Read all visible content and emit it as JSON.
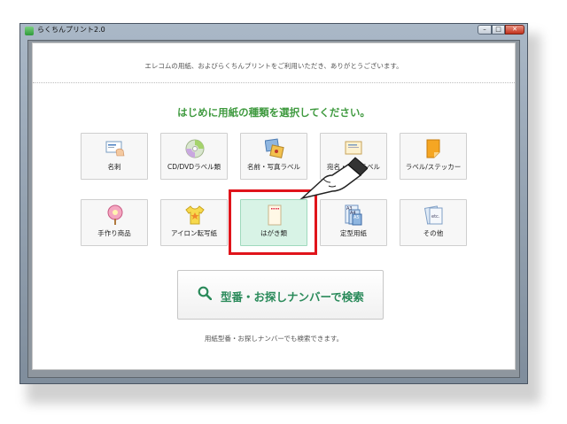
{
  "window": {
    "title": "らくちんプリント2.0",
    "min_label": "–",
    "max_label": "□",
    "close_label": "✕"
  },
  "main": {
    "welcome": "エレコムの用紙、およびらくちんプリントをご利用いただき、ありがとうございます。",
    "heading": "はじめに用紙の種類を選択してください。",
    "tiles": [
      {
        "label": "名刺",
        "icon": "business-card-icon"
      },
      {
        "label": "CD/DVDラベル類",
        "icon": "disc-icon"
      },
      {
        "label": "名前・写真ラベル",
        "icon": "photo-label-icon"
      },
      {
        "label": "宛名・表示ラベル",
        "icon": "address-label-icon"
      },
      {
        "label": "ラベル/ステッカー",
        "icon": "sticker-icon"
      },
      {
        "label": "手作り商品",
        "icon": "fan-icon"
      },
      {
        "label": "アイロン転写紙",
        "icon": "tshirt-icon"
      },
      {
        "label": "はがき類",
        "icon": "postcard-icon",
        "selected": true
      },
      {
        "label": "定型用紙",
        "icon": "paper-sizes-icon"
      },
      {
        "label": "その他",
        "icon": "other-icon"
      }
    ],
    "search_button": "型番・お探しナンバーで検索",
    "note": "用紙型番・お探しナンバーでも検索できます。"
  },
  "colors": {
    "heading": "#3f9a3f",
    "highlight": "#e0141b",
    "selected_tile": "#d8f3e6",
    "search_text": "#2a8a5a"
  }
}
